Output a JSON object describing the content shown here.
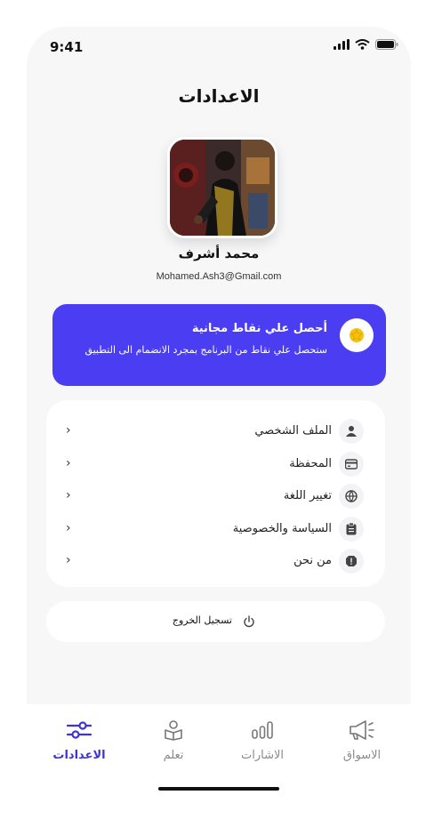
{
  "status_bar": {
    "time": "9:41"
  },
  "header": {
    "title": "الاعدادات"
  },
  "profile": {
    "name": "محمد أشرف",
    "email": "Mohamed.Ash3@Gmail.com"
  },
  "promo": {
    "title": "أحصل علي نقاط مجانية",
    "text": "ستحصل علي نقاط من البرنامج بمجرد الانضمام الى التطبيق",
    "icon": "star-badge-icon"
  },
  "menu": {
    "items": [
      {
        "label": "الملف الشخصي",
        "icon": "user-icon"
      },
      {
        "label": "المحفظة",
        "icon": "wallet-card-icon"
      },
      {
        "label": "تغيير اللغة",
        "icon": "globe-icon"
      },
      {
        "label": "السياسة والخصوصية",
        "icon": "clipboard-icon"
      },
      {
        "label": "من نحن",
        "icon": "info-shield-icon"
      }
    ]
  },
  "logout": {
    "label": "تسجيل الخروج",
    "icon": "power-icon"
  },
  "tabbar": {
    "tabs": [
      {
        "label": "الاعدادات",
        "icon": "sliders-icon",
        "active": true
      },
      {
        "label": "تعلم",
        "icon": "learn-reader-icon",
        "active": false
      },
      {
        "label": "الاشارات",
        "icon": "signals-bars-icon",
        "active": false
      },
      {
        "label": "الاسواق",
        "icon": "megaphone-icon",
        "active": false
      }
    ]
  },
  "colors": {
    "accent": "#4b3ef2",
    "active_tab": "#3d33d9",
    "background": "#f7f7f7",
    "star": "#f6c20f"
  }
}
